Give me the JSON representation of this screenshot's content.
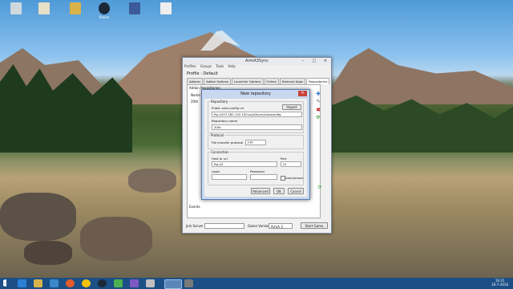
{
  "desktop": {
    "icons": [
      {
        "label": "",
        "icon": "recycle-bin-icon",
        "color": "#cfd8dc"
      },
      {
        "label": "",
        "icon": "file-icon",
        "color": "#e6e0c8"
      },
      {
        "label": "",
        "icon": "folder-icon",
        "color": "#d9b24a"
      },
      {
        "label": "Steam",
        "icon": "steam-icon",
        "color": "#1b2838"
      },
      {
        "label": "",
        "icon": "app-icon",
        "color": "#3b5b9a"
      },
      {
        "label": "",
        "icon": "document-icon",
        "color": "#eeeeee"
      }
    ]
  },
  "main_window": {
    "title": "ArmA3Sync",
    "menu": [
      "Profiles",
      "Groups",
      "Tools",
      "Help"
    ],
    "profile_label": "Profile : Default",
    "tabs": [
      "Addons",
      "Addon Options",
      "Launcher Options",
      "Online",
      "External Apps",
      "Repositories"
    ],
    "active_tab": "Repositories",
    "panel_title": "Addon Repositories",
    "column_header": "Name",
    "row": "20th",
    "events_label": "Events",
    "join_server_label": "Join Server",
    "game_version_label": "Game Version",
    "game_version_value": "ArmA 3",
    "start_game_label": "Start Game"
  },
  "dialog": {
    "title": "New repository",
    "repository_group": "Repository",
    "public_url_label": "Public auto-config url",
    "public_url_value": "ftp://207.182.152.100:xx/a3sync/autoconfig",
    "import_label": "Import",
    "repo_name_label": "Repository name",
    "repo_name_value": "20th",
    "protocol_group": "Protocol",
    "protocol_label": "File transfer protocol",
    "protocol_value": "FTP",
    "connection_group": "Connection",
    "host_label": "Host or url",
    "host_value": "ftp://2",
    "port_label": "Port",
    "port_value": "21",
    "login_label": "Login",
    "login_value": "",
    "password_label": "Password",
    "password_value": "",
    "anonymous_label": "Anonymous",
    "advanced_label": "Advanced",
    "ok_label": "OK",
    "cancel_label": "Cancel"
  },
  "taskbar": {
    "time": "19:31",
    "date": "20-7-2016",
    "accent": "#1b4f86"
  }
}
